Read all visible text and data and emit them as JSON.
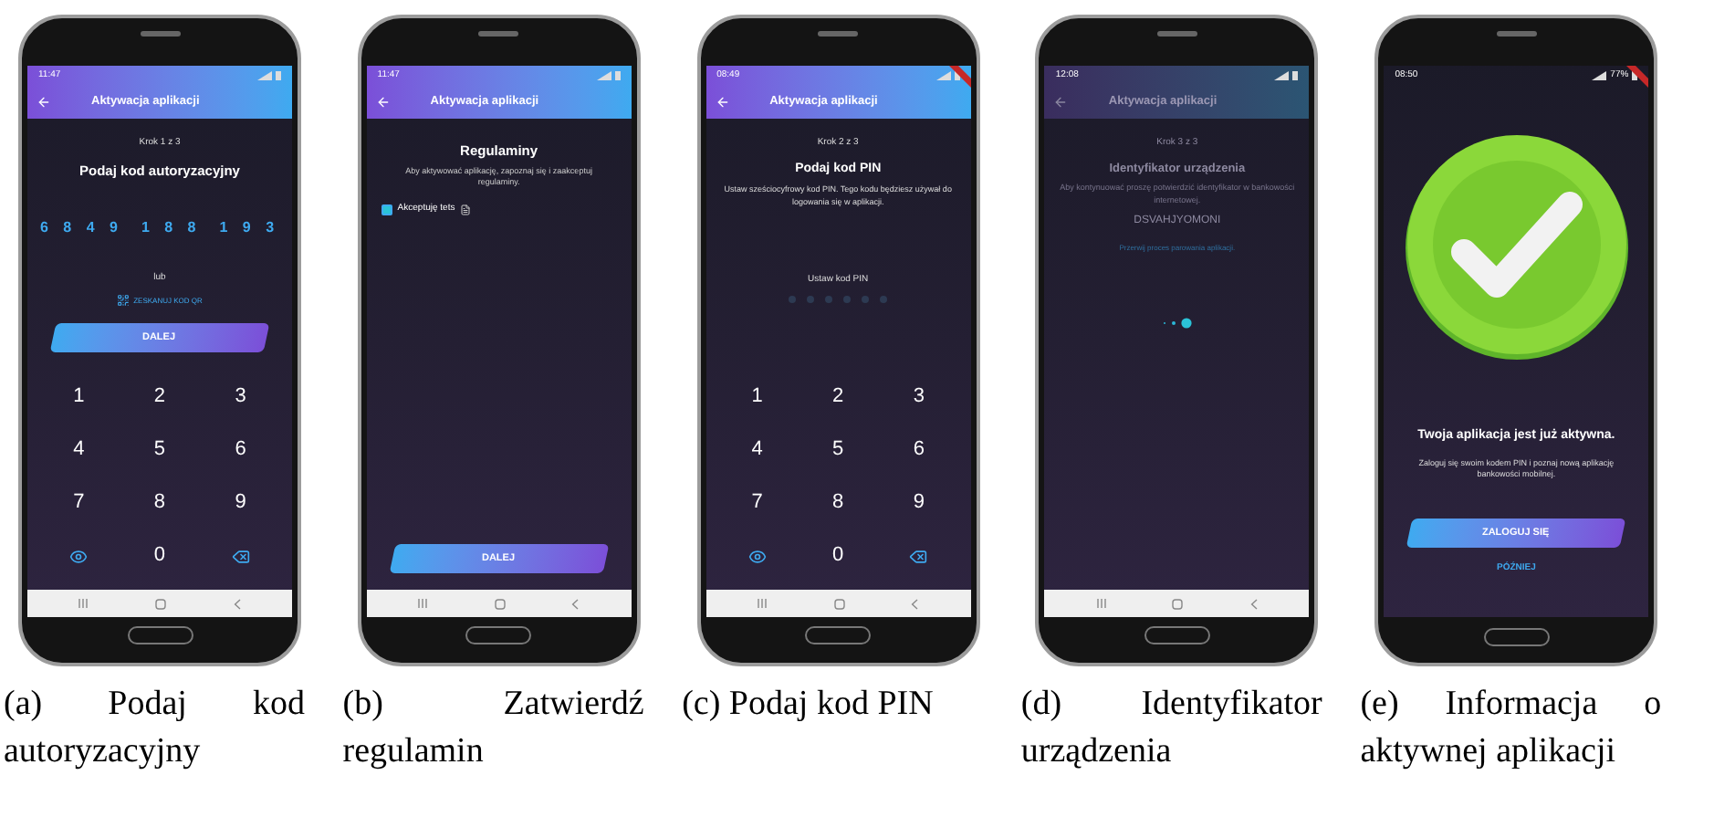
{
  "screens": [
    {
      "kind": "code",
      "status": {
        "time": "11:47"
      },
      "app_bar": {
        "title": "Aktywacja aplikacji",
        "dimmed": false
      },
      "step": "Krok 1 z 3",
      "heading": "Podaj kod autoryzacyjny",
      "code_groups": [
        "6 8 4 9",
        "1 8 8",
        "1 9 3"
      ],
      "or": "lub",
      "qr_link": "ZESKANUJ KOD QR",
      "button": "DALEJ",
      "keypad": [
        {
          "kind": "digit",
          "label": "1"
        },
        {
          "kind": "digit",
          "label": "2"
        },
        {
          "kind": "digit",
          "label": "3"
        },
        {
          "kind": "digit",
          "label": "4"
        },
        {
          "kind": "digit",
          "label": "5"
        },
        {
          "kind": "digit",
          "label": "6"
        },
        {
          "kind": "digit",
          "label": "7"
        },
        {
          "kind": "digit",
          "label": "8"
        },
        {
          "kind": "digit",
          "label": "9"
        },
        {
          "kind": "eye"
        },
        {
          "kind": "digit",
          "label": "0"
        },
        {
          "kind": "backspace"
        }
      ],
      "debug_banner": false,
      "caption": "(a) Podaj kod autoryzacyjny"
    },
    {
      "kind": "terms",
      "status": {
        "time": "11:47"
      },
      "app_bar": {
        "title": "Aktywacja aplikacji",
        "dimmed": false
      },
      "heading": "Regulaminy",
      "text": "Aby aktywować aplikację, zapoznaj się i zaakceptuj regulaminy.",
      "checkbox": {
        "label": "Akceptuję tets",
        "checked": true
      },
      "button": "DALEJ",
      "debug_banner": false,
      "caption": "(b) Zatwierdź regulamin"
    },
    {
      "kind": "pin",
      "status": {
        "time": "08:49"
      },
      "app_bar": {
        "title": "Aktywacja aplikacji",
        "dimmed": false
      },
      "step": "Krok 2 z 3",
      "heading": "Podaj kod PIN",
      "text": "Ustaw sześciocyfrowy kod PIN. Tego kodu będziesz używał do logowania się w aplikacji.",
      "pin_label": "Ustaw kod PIN",
      "pin_dots": [
        {
          "filled": false
        },
        {
          "filled": false
        },
        {
          "filled": false
        },
        {
          "filled": false
        },
        {
          "filled": false
        },
        {
          "filled": false
        }
      ],
      "keypad": [
        {
          "kind": "digit",
          "label": "1"
        },
        {
          "kind": "digit",
          "label": "2"
        },
        {
          "kind": "digit",
          "label": "3"
        },
        {
          "kind": "digit",
          "label": "4"
        },
        {
          "kind": "digit",
          "label": "5"
        },
        {
          "kind": "digit",
          "label": "6"
        },
        {
          "kind": "digit",
          "label": "7"
        },
        {
          "kind": "digit",
          "label": "8"
        },
        {
          "kind": "digit",
          "label": "9"
        },
        {
          "kind": "eye"
        },
        {
          "kind": "digit",
          "label": "0"
        },
        {
          "kind": "backspace"
        }
      ],
      "debug_banner": true,
      "caption": "(c) Podaj kod PIN"
    },
    {
      "kind": "device",
      "status": {
        "time": "12:08"
      },
      "app_bar": {
        "title": "Aktywacja aplikacji",
        "dimmed": true
      },
      "step": "Krok 3 z 3",
      "heading": "Identyfikator urządzenia",
      "text": "Aby kontynuować proszę potwierdzić identyfikator w bankowości internetowej.",
      "device_id": "DSVAHJYOMONI",
      "link": "Przerwij proces parowania aplikacji.",
      "debug_banner": false,
      "caption": "(d) Identyfikator urządzenia"
    },
    {
      "kind": "success",
      "status": {
        "time": "08:50",
        "battery": "77%"
      },
      "heading": "Twoja aplikacja jest już aktywna.",
      "text": "Zaloguj się swoim kodem PIN i poznaj nową aplikację bankowości mobilnej.",
      "button": "ZALOGUJ SIĘ",
      "link": "PÓŹNIEJ",
      "debug_banner": true,
      "caption": "(e) Informacja o aktywnej aplikacji"
    }
  ]
}
